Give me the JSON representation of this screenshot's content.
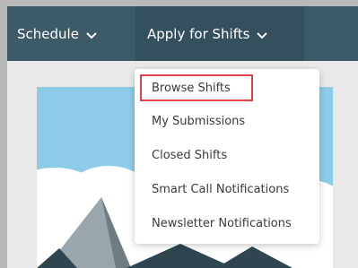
{
  "nav": {
    "items": [
      {
        "label": "Schedule",
        "icon": "chevron-down-icon"
      },
      {
        "label": "Apply for Shifts",
        "icon": "chevron-down-icon",
        "expanded": true
      }
    ]
  },
  "dropdown": {
    "items": [
      {
        "label": "Browse Shifts",
        "highlighted": true
      },
      {
        "label": "My Submissions"
      },
      {
        "label": "Closed Shifts"
      },
      {
        "label": "Smart Call Notifications"
      },
      {
        "label": "Newsletter Notifications"
      }
    ]
  },
  "colors": {
    "navbar": "#3d5a68",
    "navbar_active": "#34505d",
    "highlight_border": "#e0404a",
    "sky": "#8ecbe8",
    "mountain": "#2f4550"
  }
}
